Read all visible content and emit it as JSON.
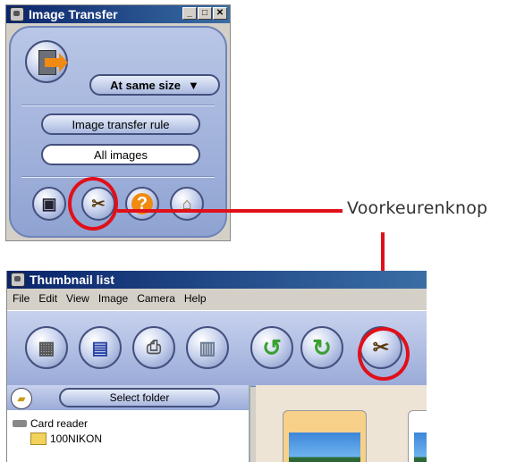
{
  "image_transfer": {
    "title": "Image Transfer",
    "size_option": "At same size",
    "rule_button": "Image transfer rule",
    "rule_value": "All images"
  },
  "callout": {
    "label": "Voorkeurenknop"
  },
  "thumbnail_list": {
    "title": "Thumbnail list",
    "menu": [
      "File",
      "Edit",
      "View",
      "Image",
      "Camera",
      "Help"
    ],
    "folder_button": "Select folder",
    "tree": {
      "root": "Card reader",
      "folder": "100NIKON"
    }
  },
  "colors": {
    "highlight": "#e0101a",
    "panel_blue": "#9aabd8"
  }
}
